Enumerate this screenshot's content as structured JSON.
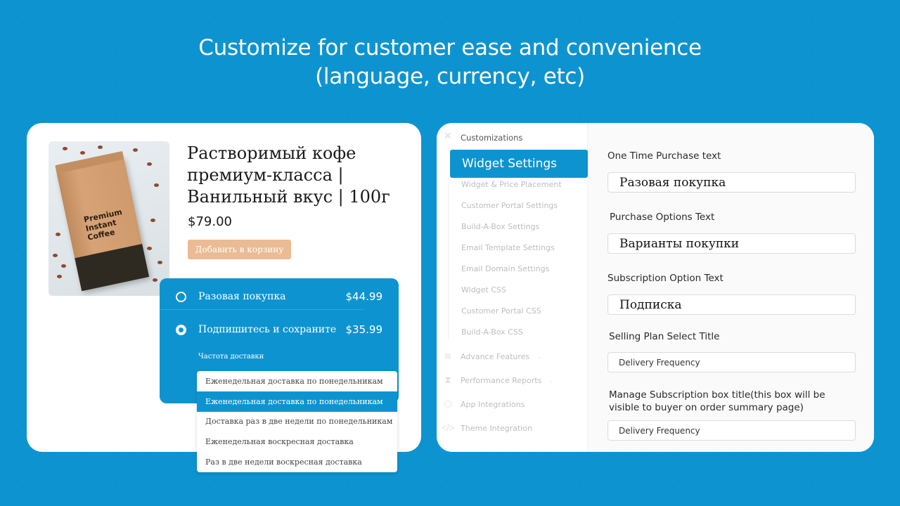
{
  "headline": {
    "line1": "Customize for customer ease and convenience",
    "line2": "(language, currency, etc)"
  },
  "product": {
    "image_alt": "coffee-bag-image",
    "bag_label": [
      "Premium",
      "Instant",
      "Coffee"
    ],
    "title": "Растворимый кофе премиум-класса | Ванильный вкус | 100г",
    "price": "$79.00",
    "add_to_cart_label": "Добавить в корзину"
  },
  "widget": {
    "options": [
      {
        "label": "Разовая покупка",
        "price": "$44.99",
        "selected": false
      },
      {
        "label": "Подпишитесь и сохраните",
        "price": "$35.99",
        "selected": true
      }
    ],
    "frequency_label": "Частота доставки",
    "dropdown": {
      "selected": "Еженедельная доставка по понедельникам",
      "options": [
        "Еженедельная доставка по понедельникам",
        "Доставка раз в две недели по понедельникам",
        "Еженедельная воскресная доставка",
        "Раз в две недели воскресная доставка"
      ],
      "highlighted_index": 0
    }
  },
  "sidebar": {
    "section": "Customizations",
    "active": "Widget Settings",
    "sub_items": [
      "Widget & Price Placement",
      "Customer Portal Settings",
      "Build-A-Box Settings",
      "Email Template Settings",
      "Email Domain Settings",
      "Widget CSS",
      "Customer Portal CSS",
      "Build-A-Box CSS"
    ],
    "groups": [
      {
        "label": "Advance Features",
        "icon": "layers-icon",
        "has_chevron": true
      },
      {
        "label": "Performance Reports",
        "icon": "hourglass-icon",
        "has_chevron": true
      },
      {
        "label": "App Integrations",
        "icon": "integrations-icon",
        "has_chevron": false
      },
      {
        "label": "Theme Integration",
        "icon": "code-icon",
        "has_chevron": false
      }
    ]
  },
  "form": {
    "fields": [
      {
        "label": "One Time Purchase text",
        "value": "Разовая покупка"
      },
      {
        "label": "Purchase Options Text",
        "value": "Варианты покупки"
      },
      {
        "label": "Subscription Option Text",
        "value": "Подписка"
      },
      {
        "label": "Selling Plan Select Title",
        "value": "Delivery Frequency"
      },
      {
        "label": "Manage Subscription box title(this box will be visible to buyer on order summary page)",
        "value": "Delivery Frequency"
      }
    ]
  }
}
